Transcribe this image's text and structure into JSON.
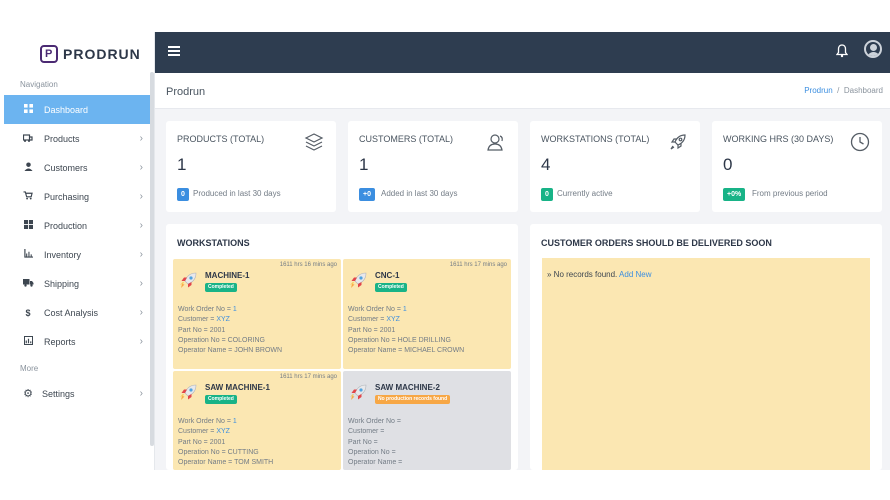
{
  "brand": {
    "name": "PRODRUN"
  },
  "sidebar": {
    "section_navigation": "Navigation",
    "section_more": "More",
    "items": [
      {
        "label": "Dashboard",
        "icon": "dashboard-icon",
        "active": true
      },
      {
        "label": "Products",
        "icon": "products-icon"
      },
      {
        "label": "Customers",
        "icon": "user-icon"
      },
      {
        "label": "Purchasing",
        "icon": "cart-icon"
      },
      {
        "label": "Production",
        "icon": "grid-icon"
      },
      {
        "label": "Inventory",
        "icon": "inventory-icon"
      },
      {
        "label": "Shipping",
        "icon": "truck-icon"
      },
      {
        "label": "Cost Analysis",
        "icon": "dollar-icon"
      },
      {
        "label": "Reports",
        "icon": "reports-icon"
      }
    ],
    "settings": {
      "label": "Settings",
      "icon": "gear-icon"
    }
  },
  "header": {
    "page_title": "Prodrun"
  },
  "breadcrumb": {
    "root": "Prodrun",
    "separator": "/",
    "current": "Dashboard"
  },
  "stats": [
    {
      "label": "PRODUCTS (TOTAL)",
      "value": "1",
      "badge": "0",
      "badge_color": "#3b8ee0",
      "sub": "Produced in last 30 days",
      "icon": "layers-icon"
    },
    {
      "label": "CUSTOMERS (TOTAL)",
      "value": "1",
      "badge": "+0",
      "badge_color": "#3b8ee0",
      "sub": "Added in last 30 days",
      "icon": "customers-icon"
    },
    {
      "label": "WORKSTATIONS (TOTAL)",
      "value": "4",
      "badge": "0",
      "badge_color": "#18b387",
      "sub": "Currently active",
      "icon": "rocket-icon"
    },
    {
      "label": "WORKING HRS (30 DAYS)",
      "value": "0",
      "badge": "+0%",
      "badge_color": "#18b387",
      "sub": "From previous period",
      "icon": "clock-icon"
    }
  ],
  "workstations": {
    "title": "WORKSTATIONS",
    "labels": {
      "work_order": "Work Order No = ",
      "customer": "Customer = ",
      "part": "Part No = ",
      "operation": "Operation No = ",
      "operator": "Operator Name = "
    },
    "items": [
      {
        "name": "MACHINE-1",
        "time": "1611 hrs 16 mins ago",
        "status": "Completed",
        "work_order": "1",
        "customer": "XYZ",
        "part": "2001",
        "operation": "COLORING",
        "operator": "JOHN BROWN"
      },
      {
        "name": "CNC-1",
        "time": "1611 hrs 17 mins ago",
        "status": "Completed",
        "work_order": "1",
        "customer": "XYZ",
        "part": "2001",
        "operation": "HOLE DRILLING",
        "operator": "MICHAEL CROWN"
      },
      {
        "name": "SAW MACHINE-1",
        "time": "1611 hrs 17 mins ago",
        "status": "Completed",
        "work_order": "1",
        "customer": "XYZ",
        "part": "2001",
        "operation": "CUTTING",
        "operator": "TOM SMITH"
      },
      {
        "name": "SAW MACHINE-2",
        "time": "",
        "status": "No production records found",
        "work_order": "",
        "customer": "",
        "part": "",
        "operation": "",
        "operator": ""
      }
    ]
  },
  "orders": {
    "title": "CUSTOMER ORDERS SHOULD BE DELIVERED SOON",
    "empty": "» No records found.",
    "add_new": "Add New"
  },
  "colors": {
    "topbar": "#2e3d50",
    "active_nav": "#6cb4f0",
    "card_yellow": "#fbe7b2",
    "card_grey": "#dfe0e4"
  }
}
